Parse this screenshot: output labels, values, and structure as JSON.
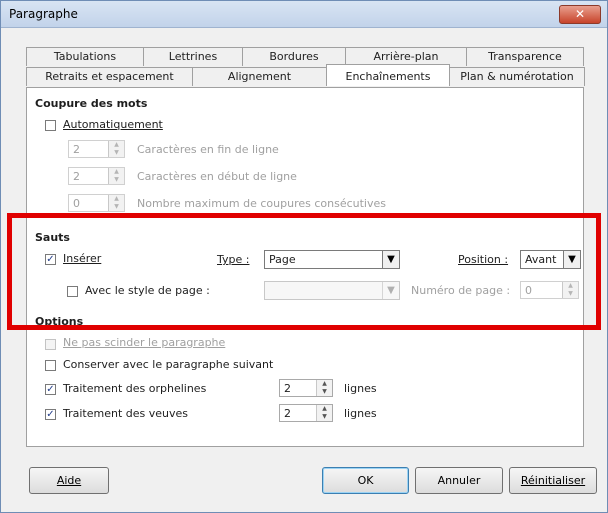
{
  "window": {
    "title": "Paragraphe",
    "close_glyph": "✕"
  },
  "tabs": {
    "row1": [
      "Tabulations",
      "Lettrines",
      "Bordures",
      "Arrière-plan",
      "Transparence"
    ],
    "row2": [
      "Retraits et espacement",
      "Alignement",
      "Enchaînements",
      "Plan & numérotation"
    ],
    "active": "Enchaînements"
  },
  "hyphenation": {
    "heading": "Coupure des mots",
    "auto_label": "Automatiquement",
    "auto_checked": false,
    "end_value": "2",
    "end_label": "Caractères en fin de ligne",
    "start_value": "2",
    "start_label": "Caractères en début de ligne",
    "max_value": "0",
    "max_label": "Nombre maximum de coupures consécutives"
  },
  "breaks": {
    "heading": "Sauts",
    "insert_label": "Insérer",
    "insert_checked": true,
    "type_label": "Type :",
    "type_value": "Page",
    "position_label": "Position :",
    "position_value": "Avant",
    "page_style_label": "Avec le style de page :",
    "page_style_checked": false,
    "page_style_value": "",
    "page_number_label": "Numéro de page :",
    "page_number_value": "0"
  },
  "options": {
    "heading": "Options",
    "no_split_label": "Ne pas scinder le paragraphe",
    "no_split_checked": false,
    "keep_next_label": "Conserver avec le paragraphe suivant",
    "keep_next_checked": false,
    "orphans_label": "Traitement des orphelines",
    "orphans_checked": true,
    "orphans_value": "2",
    "orphans_unit": "lignes",
    "widows_label": "Traitement des veuves",
    "widows_checked": true,
    "widows_value": "2",
    "widows_unit": "lignes"
  },
  "buttons": {
    "help": "Aide",
    "ok": "OK",
    "cancel": "Annuler",
    "reset": "Réinitialiser"
  },
  "glyphs": {
    "check": "✓",
    "drop": "▼",
    "spin_up": "▲",
    "spin_down": "▼"
  },
  "colors": {
    "highlight": "#e00000",
    "accent": "#3c7fb1"
  }
}
